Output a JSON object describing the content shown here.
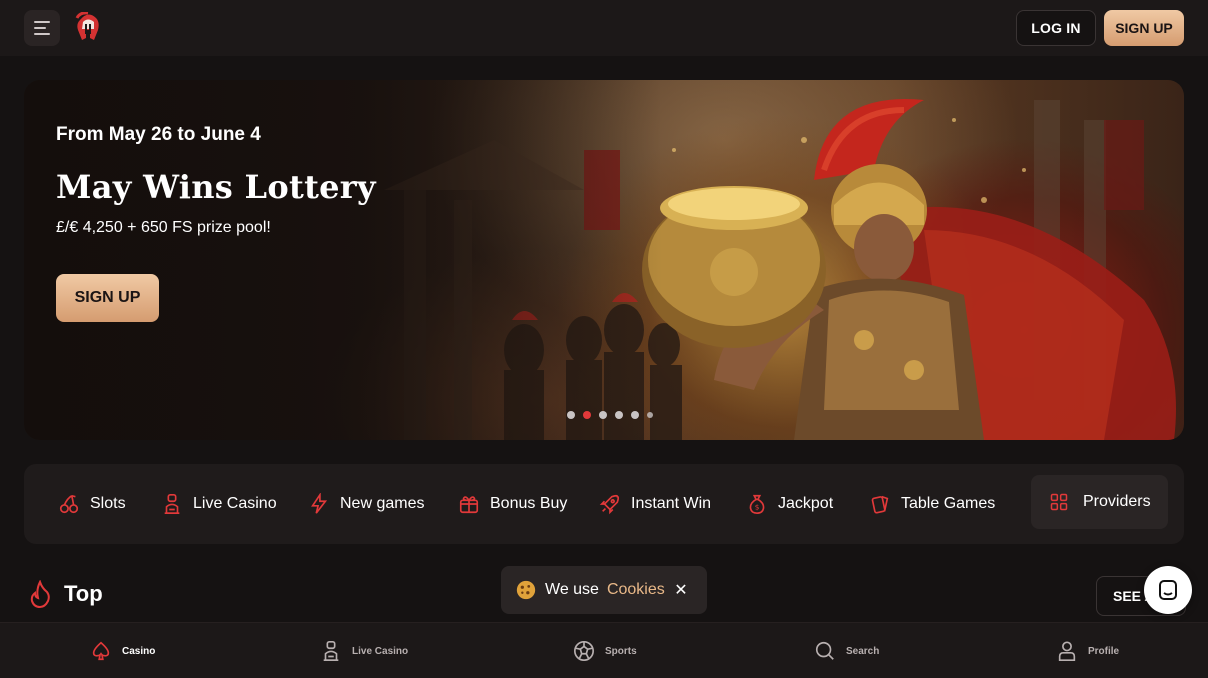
{
  "header": {
    "login_label": "LOG IN",
    "signup_label": "SIGN UP",
    "logo_icon": "spartan-helmet-logo",
    "menu_icon": "menu-icon"
  },
  "hero": {
    "date": "From May 26 to June 4",
    "title": "May Wins Lottery",
    "subtitle": "£/€ 4,250 + 650 FS prize pool!",
    "cta_label": "SIGN UP",
    "slides_total": 6,
    "active_slide": 2
  },
  "categories": {
    "slots": "Slots",
    "live_casino": "Live Casino",
    "new_games": "New games",
    "bonus_buy": "Bonus Buy",
    "instant_win": "Instant Win",
    "jackpot": "Jackpot",
    "table_games": "Table Games",
    "providers": "Providers"
  },
  "top_section": {
    "title": "Top",
    "see_all_label": "SEE ALL"
  },
  "cookie": {
    "prefix": "We use",
    "link": "Cookies",
    "close_symbol": "✕"
  },
  "bottom_nav": {
    "casino": "Casino",
    "live_casino": "Live Casino",
    "sports": "Sports",
    "search": "Search",
    "profile": "Profile"
  },
  "colors": {
    "accent_red": "#e2393a",
    "gold_gradient_top": "#f0c9a4",
    "gold_gradient_bottom": "#d59c70",
    "background": "#151212"
  }
}
